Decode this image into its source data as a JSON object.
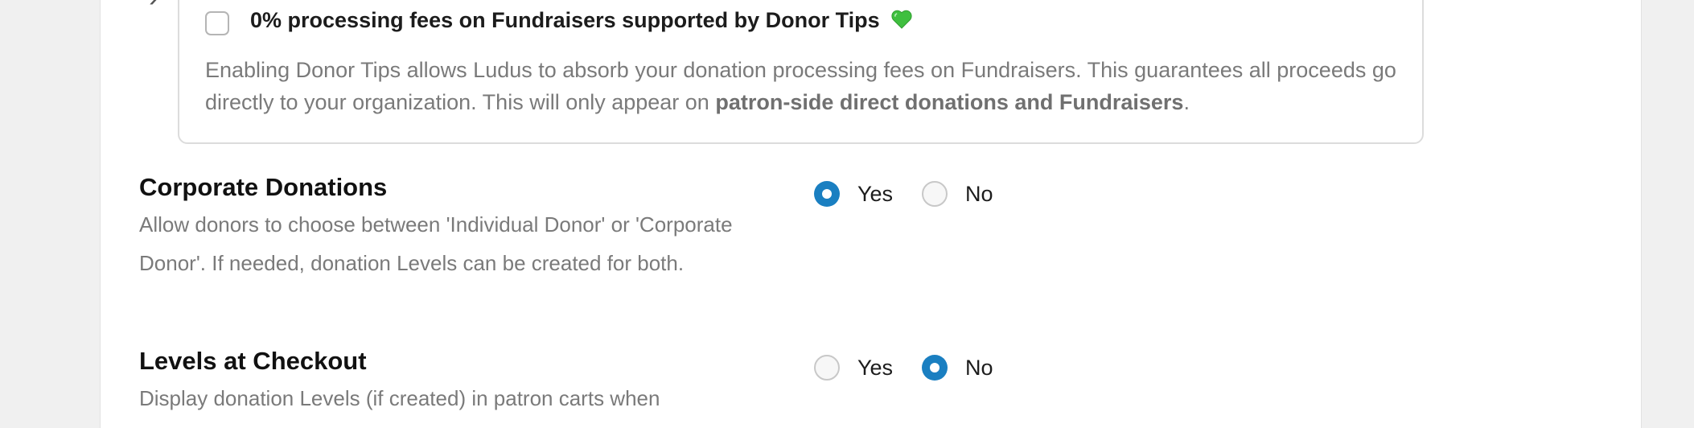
{
  "donor_tips": {
    "checkbox_label": "0% processing fees on Fundraisers supported by Donor Tips",
    "checkbox_checked": false,
    "description_part1": "Enabling Donor Tips allows Ludus to absorb your donation processing fees on Fundraisers. This guarantees all proceeds go directly to your organization. This will only appear on ",
    "description_bold": "patron-side direct donations and Fundraisers",
    "description_end": ".",
    "heart_icon": "green-heart-icon"
  },
  "corporate_donations": {
    "title": "Corporate Donations",
    "description": "Allow donors to choose between 'Individual Donor' or 'Corporate Donor'. If needed, donation Levels can be created for both.",
    "options": [
      {
        "label": "Yes",
        "checked": true
      },
      {
        "label": "No",
        "checked": false
      }
    ]
  },
  "levels_at_checkout": {
    "title": "Levels at Checkout",
    "description": "Display donation Levels (if created) in patron carts when",
    "options": [
      {
        "label": "Yes",
        "checked": false
      },
      {
        "label": "No",
        "checked": true
      }
    ]
  },
  "colors": {
    "accent": "#1a7fc1",
    "heart": "#3fbf3f"
  }
}
